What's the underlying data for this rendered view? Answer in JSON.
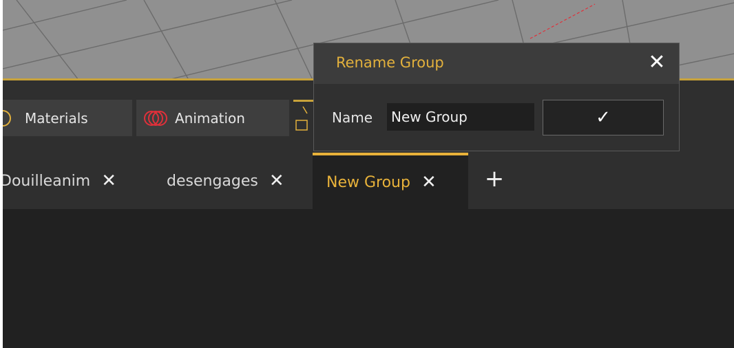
{
  "colors": {
    "accent": "#e8b23a",
    "panel_bg": "#2f2f2f",
    "dark_bg": "#212121",
    "viewport_bg": "#909090",
    "axis_red": "#e0303a"
  },
  "categories": {
    "materials": {
      "label": "Materials",
      "icon": "circle-outline-icon"
    },
    "animation": {
      "label": "Animation",
      "icon": "overlapping-circles-icon"
    }
  },
  "tabs": [
    {
      "label": "Douilleanim",
      "active": false
    },
    {
      "label": "desengages",
      "active": false
    },
    {
      "label": "New Group",
      "active": true
    }
  ],
  "tab_close_glyph": "✕",
  "add_tab_glyph": "+",
  "dialog": {
    "title": "Rename Group",
    "close_glyph": "✕",
    "name_label": "Name",
    "name_value": "New Group",
    "confirm_glyph": "✓"
  }
}
